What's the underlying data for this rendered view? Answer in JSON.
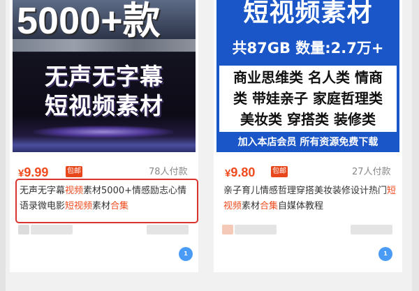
{
  "products": [
    {
      "banner": {
        "big": "5000+款",
        "line1": "无声无字幕",
        "line2": "短视频素材"
      },
      "price_symbol": "¥",
      "price": "9.99",
      "badge": "包邮",
      "sold": "78人付款",
      "desc_segments": [
        {
          "text": "无声无字幕",
          "highlight": false
        },
        {
          "text": "视频",
          "highlight": true
        },
        {
          "text": "素材5000+情感励志心情语录微电影",
          "highlight": false
        },
        {
          "text": "短视频",
          "highlight": true
        },
        {
          "text": "素材",
          "highlight": false
        },
        {
          "text": "合集",
          "highlight": true
        }
      ]
    },
    {
      "banner": {
        "title": "短视频素材",
        "stats": "共87GB 数量:2.7万+",
        "cat1": "商业思维类 名人类 情商",
        "cat2": "类 带娃亲子 家庭哲理类",
        "cat3": "美妆类 穿搭类 装修类",
        "cta": "加入本店会员 所有资源免费下载"
      },
      "price_symbol": "¥",
      "price": "9.80",
      "badge": "包邮",
      "sold": "27人付款",
      "desc_segments": [
        {
          "text": "亲子育儿情感哲理穿搭美妆装修设计热门",
          "highlight": false
        },
        {
          "text": "短视频",
          "highlight": true
        },
        {
          "text": "素材",
          "highlight": false
        },
        {
          "text": "合集",
          "highlight": true
        },
        {
          "text": "自媒体教程",
          "highlight": false
        }
      ]
    }
  ],
  "colors": {
    "price": "#f04b1e",
    "badge": "#e8471b",
    "highlight_border": "#d9342b",
    "banner_blue": "#1a56c8"
  },
  "chat_icon_label": "1"
}
